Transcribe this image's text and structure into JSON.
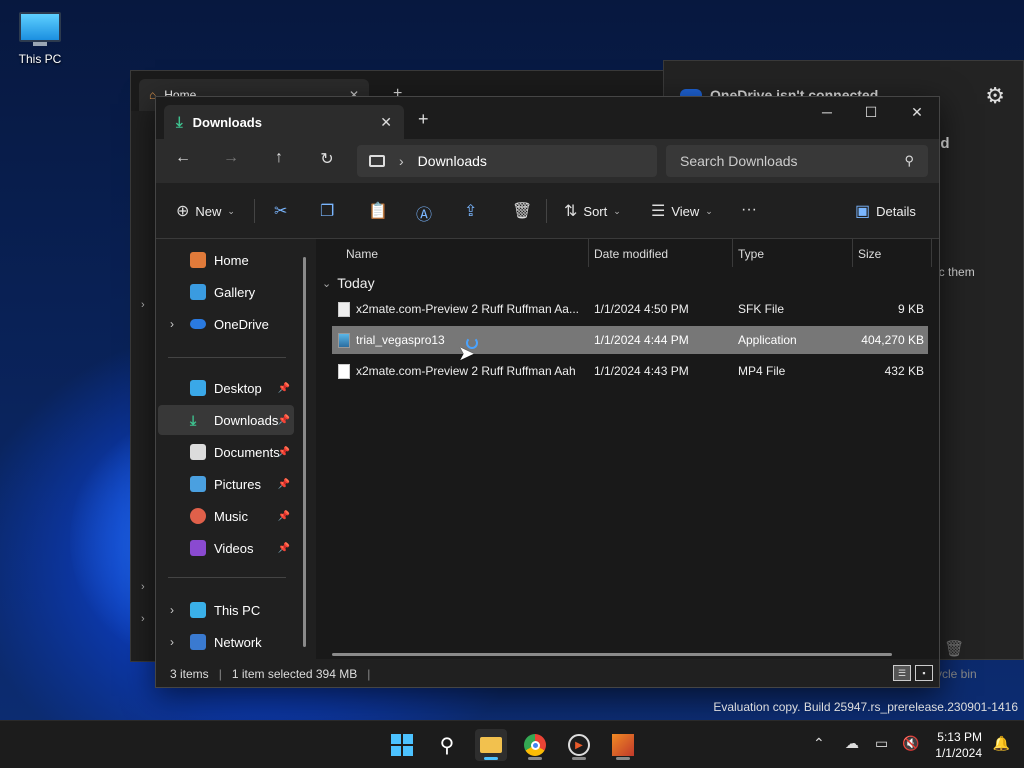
{
  "desktop": {
    "this_pc_label": "This PC"
  },
  "bg_window": {
    "tab_title": "Home",
    "close": "✕",
    "plus": "+"
  },
  "onedrive": {
    "title": "OneDrive isn't connected",
    "fragment1": "ed",
    "fragment2": "nc them",
    "fragment3": "ycle bin"
  },
  "window": {
    "tab_title": "Downloads",
    "tab_close": "✕",
    "new_tab": "+",
    "minimize": "─",
    "maximize": "☐",
    "close": "✕"
  },
  "nav": {
    "back": "←",
    "forward": "→",
    "up": "↑",
    "refresh": "↻",
    "breadcrumb": "Downloads",
    "search_placeholder": "Search Downloads"
  },
  "toolbar": {
    "new_label": "New",
    "sort_label": "Sort",
    "view_label": "View",
    "more": "···",
    "details_label": "Details"
  },
  "sidebar": {
    "items": [
      {
        "label": "Home"
      },
      {
        "label": "Gallery"
      },
      {
        "label": "OneDrive"
      },
      {
        "label": "Desktop"
      },
      {
        "label": "Downloads"
      },
      {
        "label": "Documents"
      },
      {
        "label": "Pictures"
      },
      {
        "label": "Music"
      },
      {
        "label": "Videos"
      },
      {
        "label": "This PC"
      },
      {
        "label": "Network"
      }
    ]
  },
  "columns": {
    "name": "Name",
    "date": "Date modified",
    "type": "Type",
    "size": "Size"
  },
  "group": {
    "label": "Today"
  },
  "files": [
    {
      "name": "x2mate.com-Preview 2 Ruff Ruffman Aa...",
      "date": "1/1/2024 4:50 PM",
      "type": "SFK File",
      "size": "9 KB"
    },
    {
      "name": "trial_vegaspro13",
      "date": "1/1/2024 4:44 PM",
      "type": "Application",
      "size": "404,270 KB"
    },
    {
      "name": "x2mate.com-Preview 2 Ruff Ruffman Aah",
      "date": "1/1/2024 4:43 PM",
      "type": "MP4 File",
      "size": "432 KB"
    }
  ],
  "status": {
    "items": "3 items",
    "selected": "1 item selected  394 MB"
  },
  "watermark": "Evaluation copy. Build 25947.rs_prerelease.230901-1416",
  "clock": {
    "time": "5:13 PM",
    "date": "1/1/2024"
  }
}
